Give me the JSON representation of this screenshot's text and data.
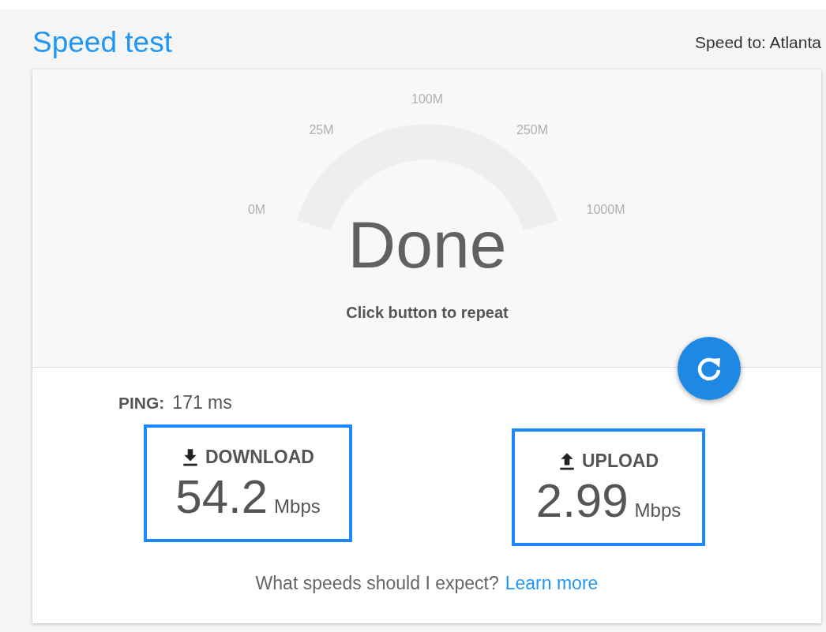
{
  "title": "Speed test",
  "server": "Speed to: Atlanta",
  "gauge": {
    "ticks": [
      "0M",
      "25M",
      "100M",
      "250M",
      "1000M"
    ],
    "status": "Done",
    "hint": "Click button to repeat"
  },
  "ping": {
    "label": "PING:",
    "value": "171 ms"
  },
  "results": [
    {
      "kind": "download",
      "label": "DOWNLOAD",
      "value": "54.2",
      "unit": "Mbps"
    },
    {
      "kind": "upload",
      "label": "UPLOAD",
      "value": "2.99",
      "unit": "Mbps"
    }
  ],
  "footer": {
    "question": "What speeds should I expect?",
    "link": "Learn more"
  }
}
